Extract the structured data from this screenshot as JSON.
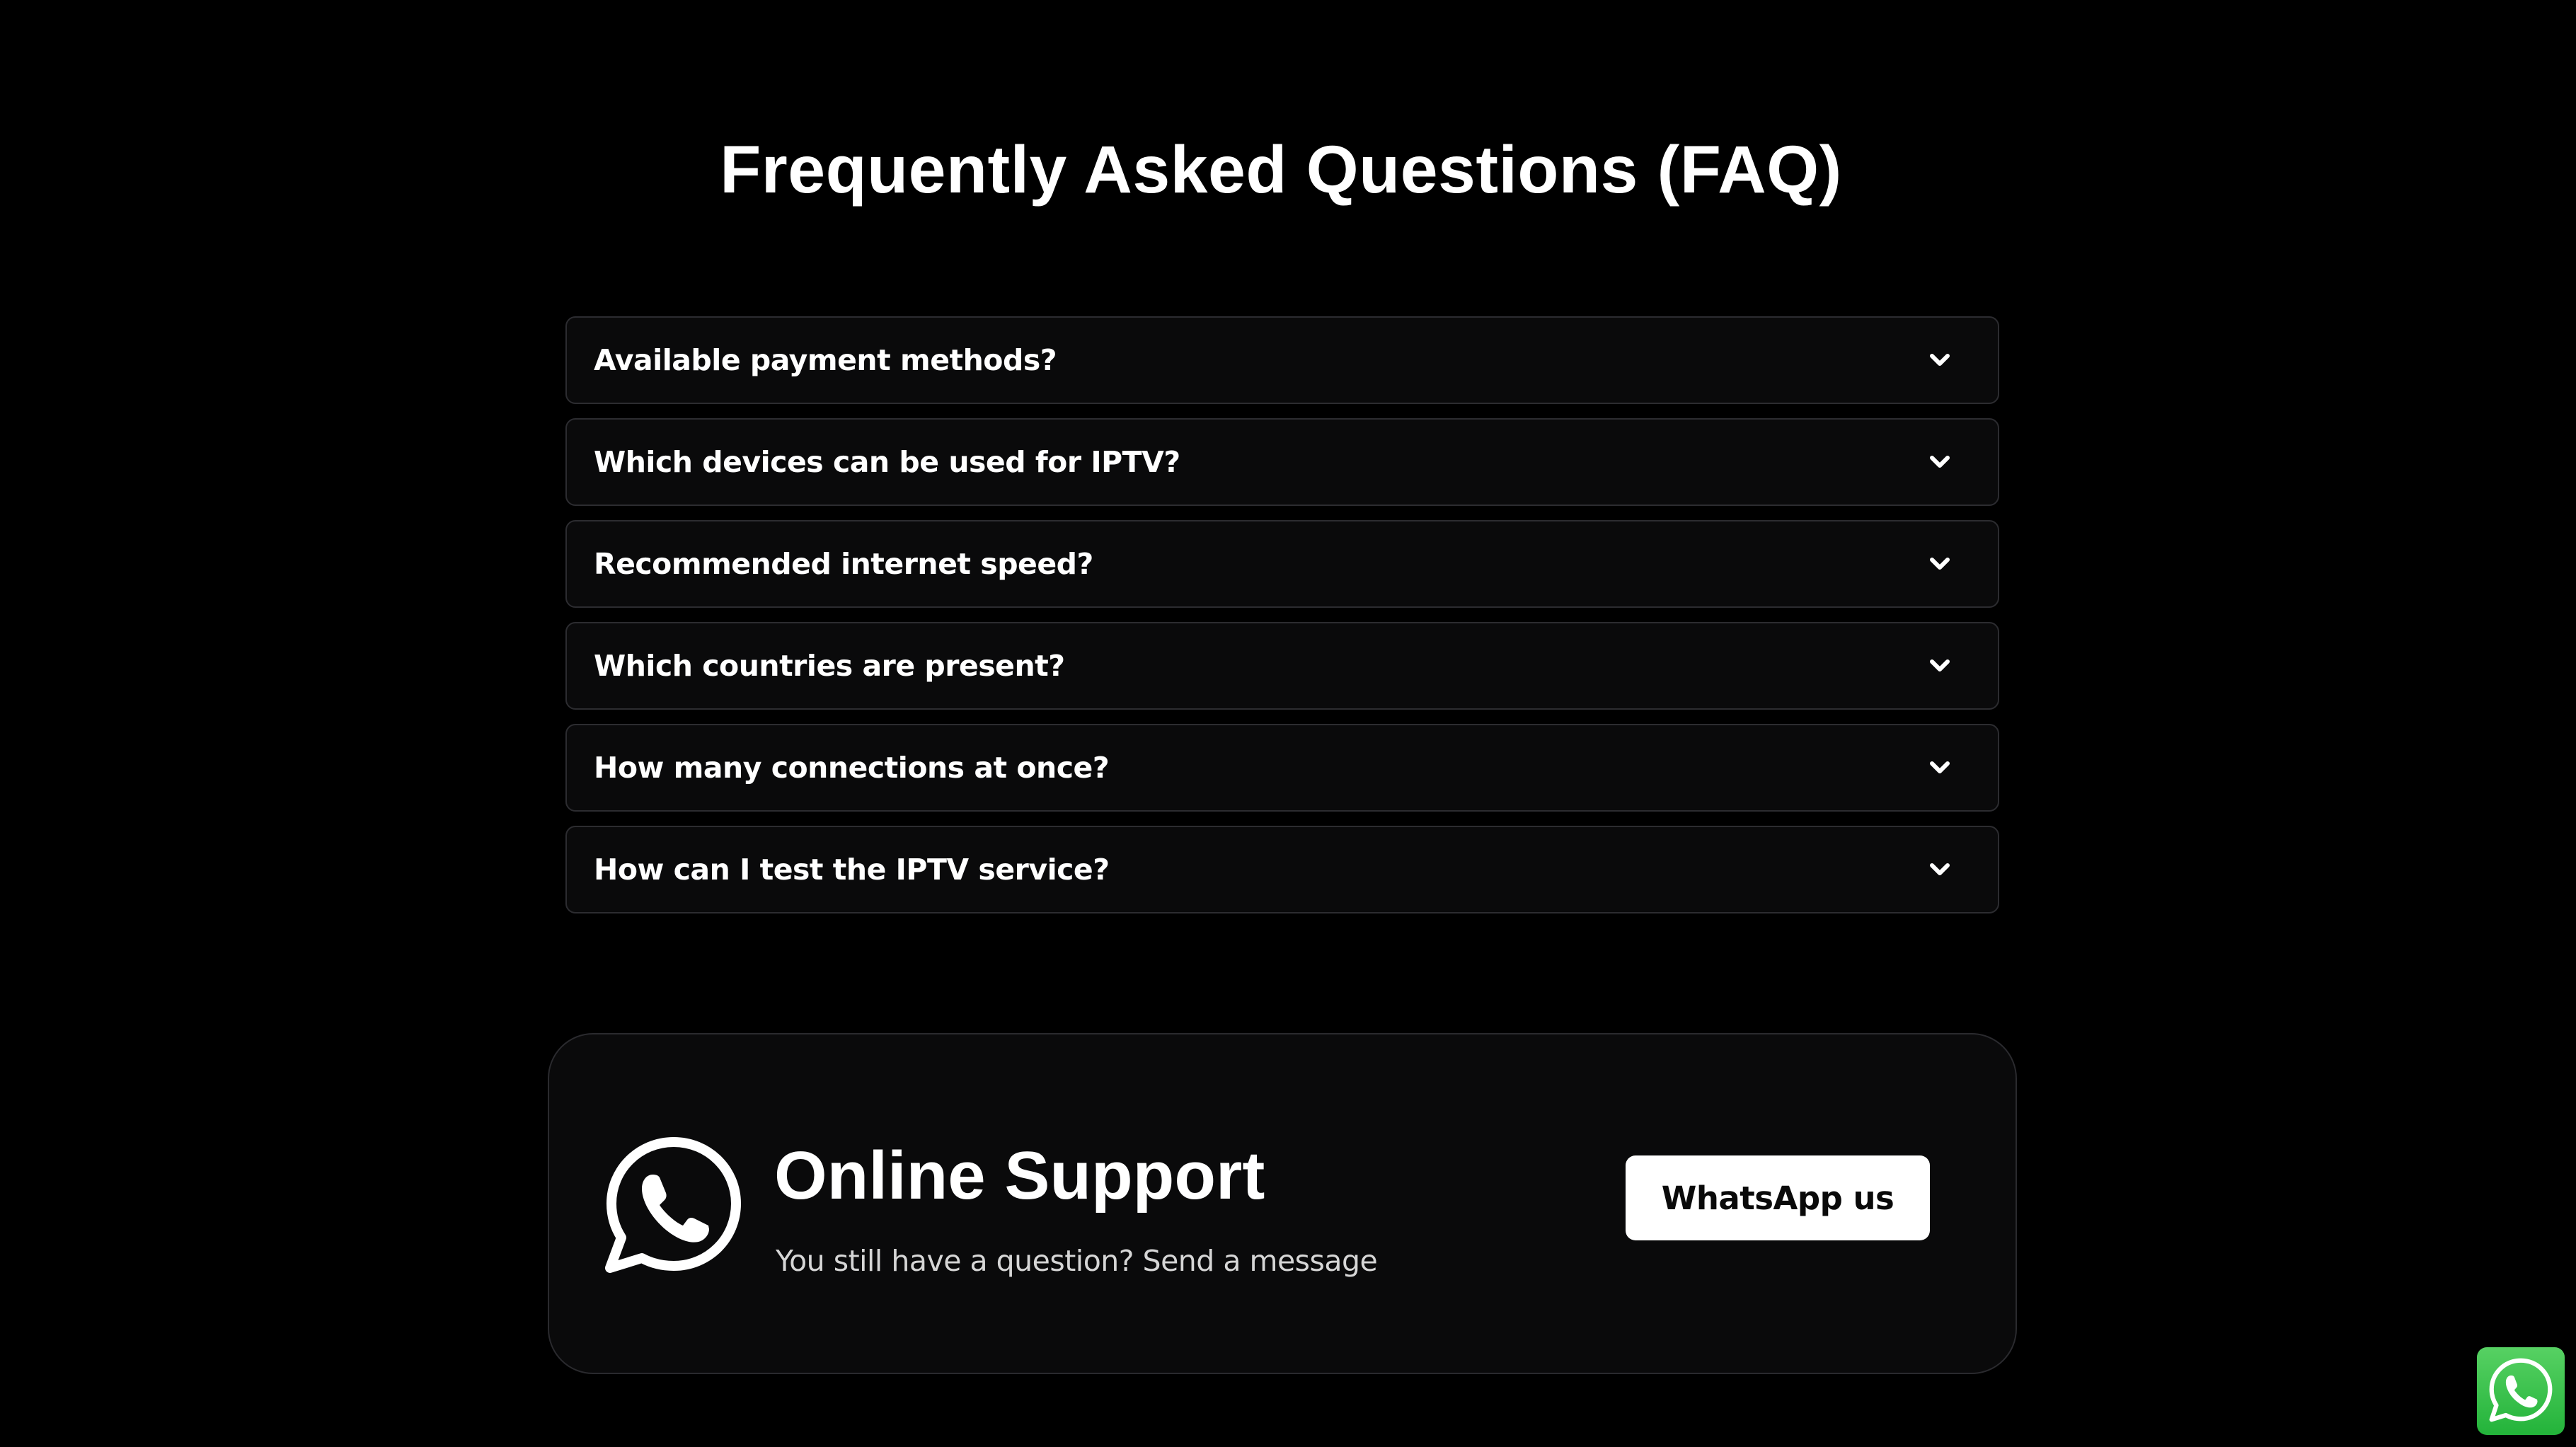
{
  "faq": {
    "title": "Frequently Asked Questions (FAQ)",
    "items": [
      {
        "question": "Available payment methods?"
      },
      {
        "question": "Which devices can be used for IPTV?"
      },
      {
        "question": "Recommended internet speed?"
      },
      {
        "question": "Which countries are present?"
      },
      {
        "question": "How many connections at once?"
      },
      {
        "question": "How can I test the IPTV service?"
      }
    ],
    "expand_icon": "chevron-down-icon"
  },
  "support": {
    "icon": "whatsapp-icon",
    "title": "Online Support",
    "subtitle": "You still have a question? Send a message",
    "button_label": "WhatsApp us"
  },
  "floating_chat": {
    "icon": "whatsapp-icon",
    "color": "#25D366"
  }
}
